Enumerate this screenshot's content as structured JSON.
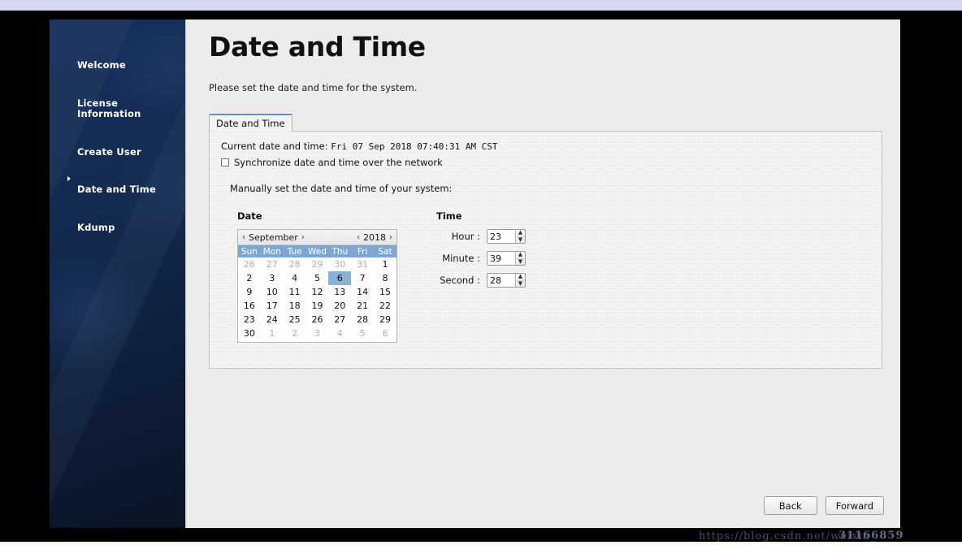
{
  "sidebar": {
    "items": [
      {
        "label": "Welcome",
        "current": false
      },
      {
        "label": "License\nInformation",
        "current": false
      },
      {
        "label": "Create User",
        "current": false
      },
      {
        "label": "Date and Time",
        "current": true
      },
      {
        "label": "Kdump",
        "current": false
      }
    ]
  },
  "main": {
    "title": "Date and Time",
    "subtitle": "Please set the date and time for the system.",
    "tab_label": "Date and Time",
    "current_label": "Current date and time:",
    "current_value": "Fri 07 Sep 2018 07:40:31 AM CST",
    "sync_label": "Synchronize date and time over the network",
    "sync_checked": false,
    "manual_label": "Manually set the date and time of your system:",
    "date_heading": "Date",
    "time_heading": "Time"
  },
  "calendar": {
    "month": "September",
    "year": "2018",
    "prev_month_icon": "‹",
    "next_month_icon": "›",
    "prev_year_icon": "‹",
    "next_year_icon": "›",
    "weekdays": [
      "Sun",
      "Mon",
      "Tue",
      "Wed",
      "Thu",
      "Fri",
      "Sat"
    ],
    "selected_day": 6,
    "header_color": "#7ea6d5",
    "selected_color": "#8ab0da",
    "weeks": [
      [
        {
          "d": "26",
          "other": true
        },
        {
          "d": "27",
          "other": true
        },
        {
          "d": "28",
          "other": true
        },
        {
          "d": "29",
          "other": true
        },
        {
          "d": "30",
          "other": true
        },
        {
          "d": "31",
          "other": true
        },
        {
          "d": "1",
          "other": false
        }
      ],
      [
        {
          "d": "2",
          "other": false
        },
        {
          "d": "3",
          "other": false
        },
        {
          "d": "4",
          "other": false
        },
        {
          "d": "5",
          "other": false
        },
        {
          "d": "6",
          "other": false,
          "sel": true
        },
        {
          "d": "7",
          "other": false
        },
        {
          "d": "8",
          "other": false
        }
      ],
      [
        {
          "d": "9",
          "other": false
        },
        {
          "d": "10",
          "other": false
        },
        {
          "d": "11",
          "other": false
        },
        {
          "d": "12",
          "other": false
        },
        {
          "d": "13",
          "other": false
        },
        {
          "d": "14",
          "other": false
        },
        {
          "d": "15",
          "other": false
        }
      ],
      [
        {
          "d": "16",
          "other": false
        },
        {
          "d": "17",
          "other": false
        },
        {
          "d": "18",
          "other": false
        },
        {
          "d": "19",
          "other": false
        },
        {
          "d": "20",
          "other": false
        },
        {
          "d": "21",
          "other": false
        },
        {
          "d": "22",
          "other": false
        }
      ],
      [
        {
          "d": "23",
          "other": false
        },
        {
          "d": "24",
          "other": false
        },
        {
          "d": "25",
          "other": false
        },
        {
          "d": "26",
          "other": false
        },
        {
          "d": "27",
          "other": false
        },
        {
          "d": "28",
          "other": false
        },
        {
          "d": "29",
          "other": false
        }
      ],
      [
        {
          "d": "30",
          "other": false
        },
        {
          "d": "1",
          "other": true
        },
        {
          "d": "2",
          "other": true
        },
        {
          "d": "3",
          "other": true
        },
        {
          "d": "4",
          "other": true
        },
        {
          "d": "5",
          "other": true
        },
        {
          "d": "6",
          "other": true
        }
      ]
    ]
  },
  "time": {
    "hour_label": "Hour :",
    "hour_value": "23",
    "minute_label": "Minute :",
    "minute_value": "39",
    "second_label": "Second :",
    "second_value": "28",
    "up_icon": "▲",
    "down_icon": "▼"
  },
  "footer": {
    "back_label": "Back",
    "forward_label": "Forward"
  },
  "watermark": {
    "text": "https://blog.csdn.net/weixin_",
    "overlap": "31166859"
  }
}
